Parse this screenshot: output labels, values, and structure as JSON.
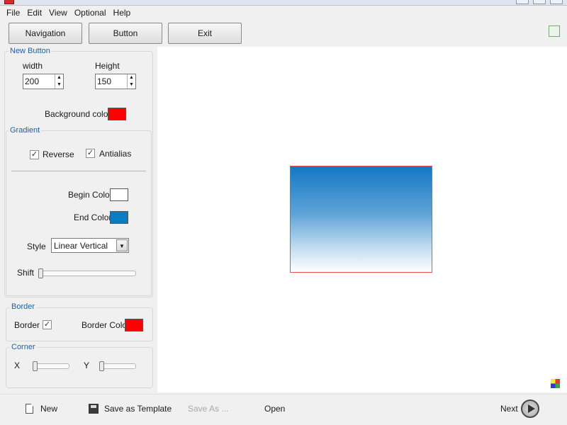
{
  "menu": [
    "File",
    "Edit",
    "View",
    "Optional",
    "Help"
  ],
  "toolbar": {
    "nav": "Navigation",
    "button": "Button",
    "exit": "Exit"
  },
  "new_button": {
    "title": "New Button",
    "width_label": "width",
    "width_value": "200",
    "height_label": "Height",
    "height_value": "150",
    "bg_label": "Background color",
    "bg_color": "#ff0000"
  },
  "gradient": {
    "title": "Gradient",
    "reverse_label": "Reverse",
    "reverse_checked": true,
    "antialias_label": "Antialias",
    "antialias_checked": true,
    "begin_label": "Begin Color",
    "begin_color": "#ffffff",
    "end_label": "End Color",
    "end_color": "#0a7cc4",
    "style_label": "Style",
    "style_value": "Linear Vertical",
    "shift_label": "Shift"
  },
  "border": {
    "title": "Border",
    "border_label": "Border",
    "border_checked": true,
    "color_label": "Border Color",
    "border_color": "#ff0000"
  },
  "corner": {
    "title": "Corner",
    "x_label": "X",
    "y_label": "Y"
  },
  "bottom": {
    "new": "New",
    "save_template": "Save as Template",
    "save_as": "Save As ...",
    "open": "Open",
    "next": "Next"
  }
}
